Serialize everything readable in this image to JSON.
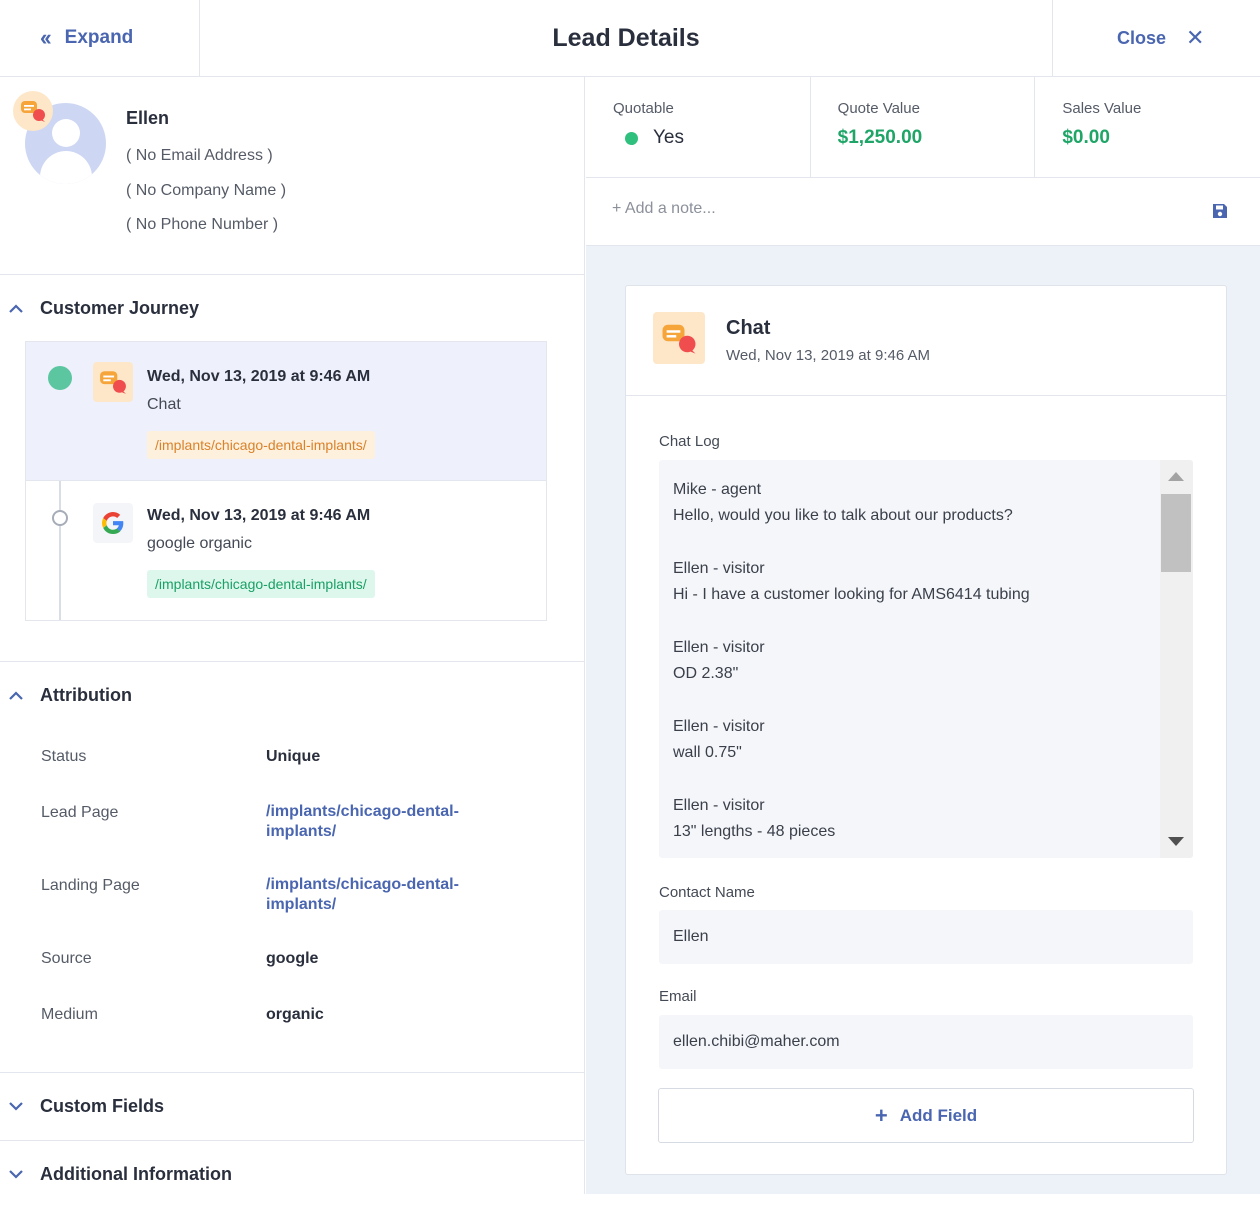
{
  "header": {
    "expand_label": "Expand",
    "title": "Lead Details",
    "close_label": "Close"
  },
  "profile": {
    "name": "Ellen",
    "email": "( No Email Address )",
    "company": "( No Company Name )",
    "phone": "( No Phone Number )"
  },
  "journey": {
    "title": "Customer Journey",
    "items": [
      {
        "date": "Wed, Nov 13, 2019 at 9:46 AM",
        "type": "Chat",
        "url": "/implants/chicago-dental-implants/",
        "icon": "chat-icon"
      },
      {
        "date": "Wed, Nov 13, 2019 at 9:46 AM",
        "type": "google organic",
        "url": "/implants/chicago-dental-implants/",
        "icon": "google-icon"
      }
    ]
  },
  "attribution": {
    "title": "Attribution",
    "rows": [
      {
        "label": "Status",
        "value": "Unique"
      },
      {
        "label": "Lead Page",
        "value": "/implants/chicago-dental-implants/"
      },
      {
        "label": "Landing Page",
        "value": "/implants/chicago-dental-implants/"
      },
      {
        "label": "Source",
        "value": "google"
      },
      {
        "label": "Medium",
        "value": "organic"
      }
    ]
  },
  "custom_fields": {
    "title": "Custom Fields"
  },
  "additional_info": {
    "title": "Additional Information"
  },
  "stats": {
    "quotable": {
      "label": "Quotable",
      "value": "Yes"
    },
    "quote_value": {
      "label": "Quote Value",
      "value": "$1,250.00"
    },
    "sales_value": {
      "label": "Sales Value",
      "value": "$0.00"
    }
  },
  "note": {
    "placeholder": "+ Add a note..."
  },
  "card": {
    "title": "Chat",
    "date": "Wed, Nov 13, 2019 at 9:46 AM",
    "chat_log_label": "Chat Log",
    "chat_log": [
      {
        "who": "Mike - agent",
        "text": "Hello, would you like to talk about our products?"
      },
      {
        "who": "Ellen - visitor",
        "text": "Hi - I have a customer looking for AMS6414 tubing"
      },
      {
        "who": "Ellen - visitor",
        "text": "OD 2.38\""
      },
      {
        "who": "Ellen - visitor",
        "text": "wall 0.75\""
      },
      {
        "who": "Ellen - visitor",
        "text": "13\" lengths - 48 pieces"
      }
    ],
    "contact_name_label": "Contact Name",
    "contact_name": "Ellen",
    "email_label": "Email",
    "email": "ellen.chibi@maher.com",
    "add_field_label": "Add Field"
  },
  "colors": {
    "accent": "#4a66b0",
    "green": "#1fa567",
    "orange_tag": "#d9822b",
    "green_tag": "#19a065"
  }
}
